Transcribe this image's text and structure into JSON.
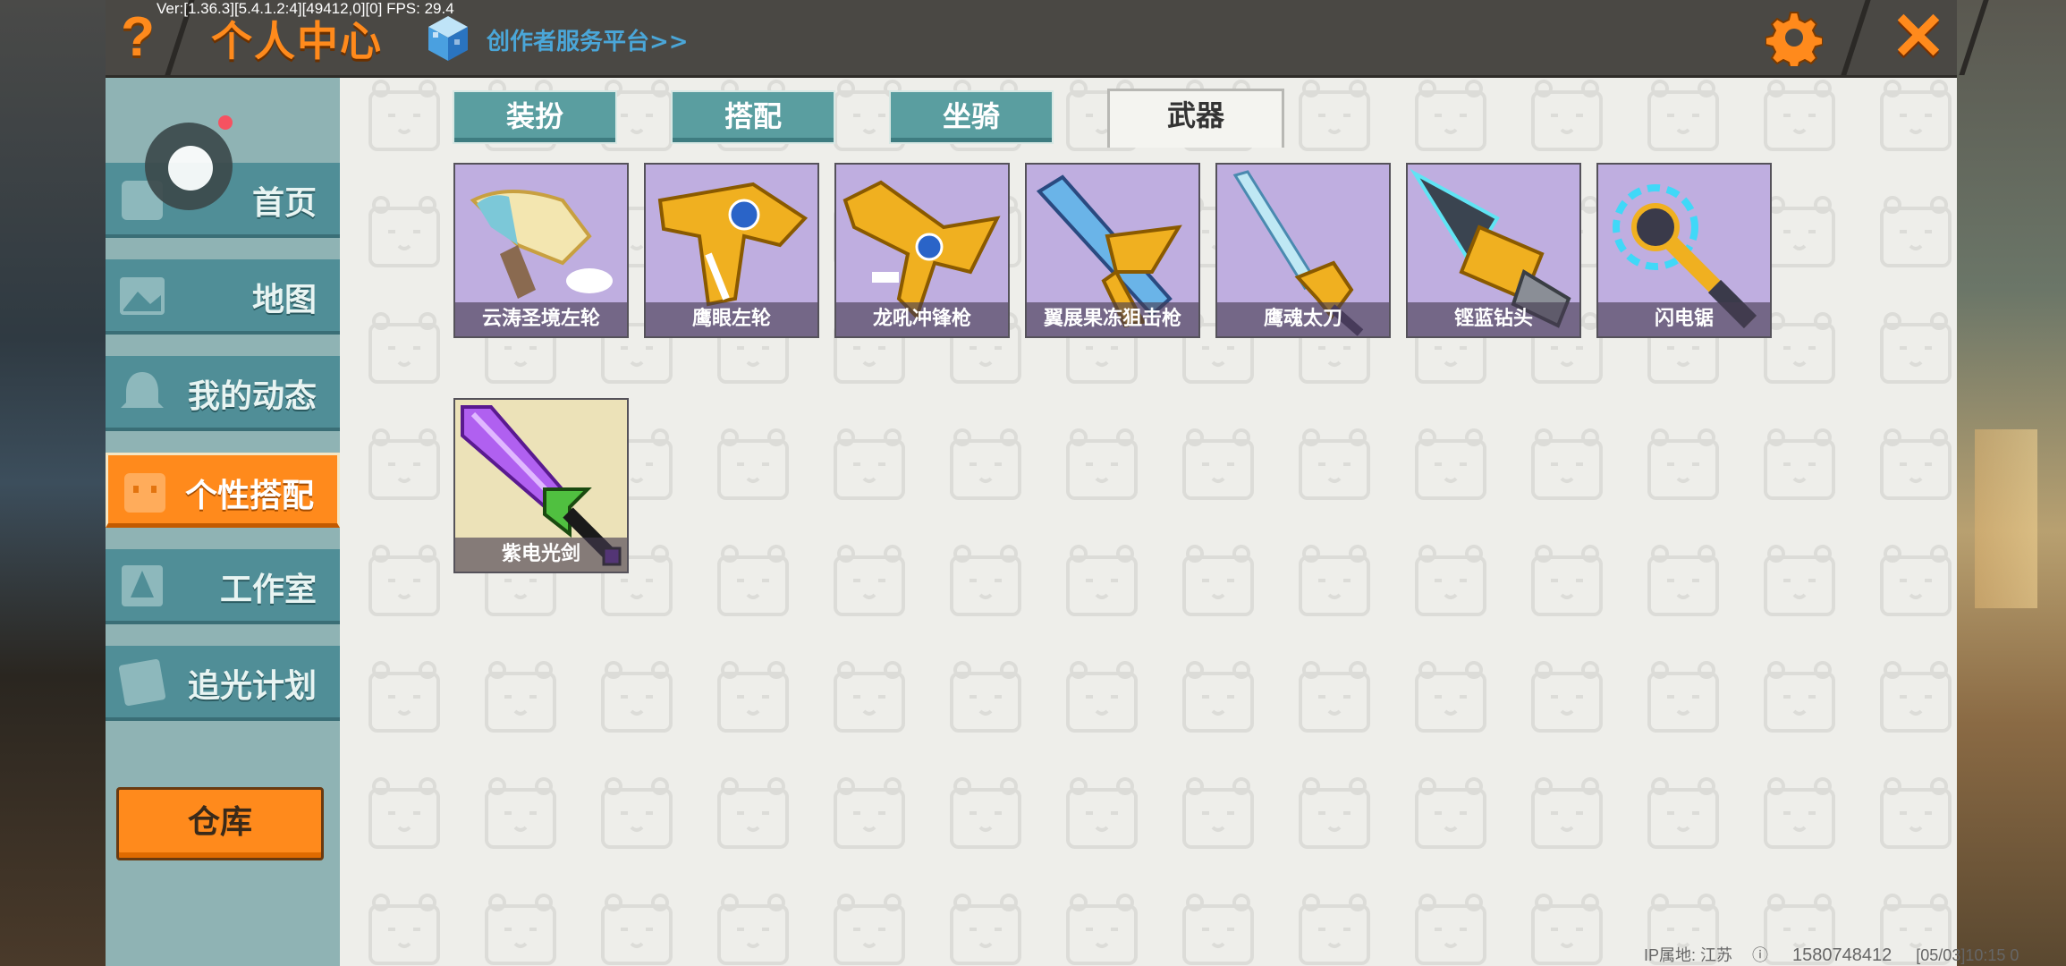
{
  "header": {
    "debug_info": "Ver:[1.36.3][5.4.1.2:4][49412,0][0] FPS: 29.4",
    "help_label": "?",
    "title": "个人中心",
    "creator_link": "创作者服务平台>>",
    "close_label": "✕"
  },
  "sidebar": {
    "items": [
      {
        "label": "首页",
        "icon": "home-icon"
      },
      {
        "label": "地图",
        "icon": "map-icon"
      },
      {
        "label": "我的动态",
        "icon": "bell-icon"
      },
      {
        "label": "个性搭配",
        "icon": "outfit-icon",
        "active": true
      },
      {
        "label": "工作室",
        "icon": "studio-icon"
      },
      {
        "label": "追光计划",
        "icon": "plan-icon"
      }
    ],
    "warehouse_label": "仓库"
  },
  "tabs": [
    {
      "label": "装扮"
    },
    {
      "label": "搭配"
    },
    {
      "label": "坐骑"
    },
    {
      "label": "武器",
      "active": true
    }
  ],
  "weapons": [
    {
      "name": "云涛圣境左轮"
    },
    {
      "name": "鹰眼左轮"
    },
    {
      "name": "龙吼冲锋枪"
    },
    {
      "name": "翼展果冻狙击枪"
    },
    {
      "name": "鹰魂太刀"
    },
    {
      "name": "铿蓝钻头"
    },
    {
      "name": "闪电锯"
    },
    {
      "name": "紫电光剑"
    }
  ],
  "footer": {
    "ip_location": "IP属地: 江苏",
    "uid": "1580748412",
    "timestamp": "[05/03]10:15 0"
  },
  "colors": {
    "accent": "#ff8a1c",
    "tab": "#5a9ea0",
    "sidebar": "#508e97",
    "card_purple": "#bfaee0"
  }
}
